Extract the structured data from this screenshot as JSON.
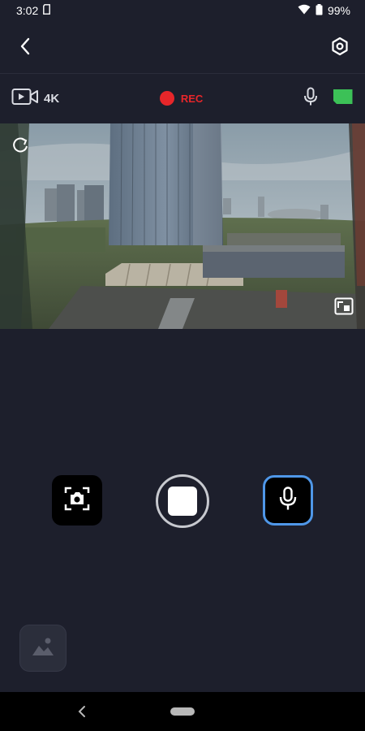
{
  "status_bar": {
    "time": "3:02",
    "battery_pct": "99%"
  },
  "info_bar": {
    "resolution": "4K",
    "rec_label": "REC"
  },
  "colors": {
    "background": "#1d1f2c",
    "rec_red": "#e7262a",
    "accent_blue": "#4f97e8",
    "sd_green": "#3cc157"
  },
  "icons": {
    "status": [
      "sd-card-icon",
      "wifi-icon",
      "battery-icon"
    ],
    "top": [
      "back-chevron-icon",
      "settings-gear-icon"
    ],
    "info": [
      "video-camera-icon",
      "microphone-icon",
      "sd-card-icon"
    ],
    "preview": [
      "rotate-icon",
      "fullscreen-icon"
    ],
    "controls": [
      "snapshot-camera-icon",
      "stop-record-icon",
      "microphone-icon"
    ],
    "gallery": "gallery-image-icon",
    "nav": [
      "nav-back-icon",
      "nav-home-pill"
    ]
  }
}
